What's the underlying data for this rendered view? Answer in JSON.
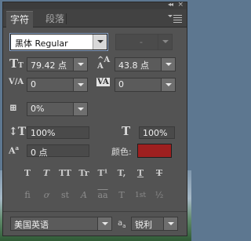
{
  "panel": {
    "tabs": [
      {
        "label": "字符",
        "active": true
      },
      {
        "label": "段落",
        "active": false
      }
    ]
  },
  "font": {
    "family": "黑体 Regular",
    "style": "-"
  },
  "size": {
    "font_size": "79.42 点",
    "leading": "43.8 点"
  },
  "spacing": {
    "kerning": "0",
    "tracking": "0"
  },
  "scale": {
    "tsume": "0%",
    "vertical": "100%",
    "horizontal": "100%"
  },
  "baseline_shift": "0 点",
  "color": {
    "label": "颜色:",
    "swatch_hex": "#9e1f1f"
  },
  "type_styles": [
    "T",
    "T",
    "TT",
    "Tr",
    "T¹",
    "T,",
    "T",
    "T"
  ],
  "opentype": [
    "fi",
    "ơ",
    "st",
    "A",
    "aa",
    "T",
    "1st",
    "½"
  ],
  "language": "美国英语",
  "antialias": {
    "label": "a",
    "value": "锐利"
  },
  "icons": [
    "collapse-icon",
    "close-icon",
    "panel-menu-icon",
    "font-size-icon",
    "leading-icon",
    "kerning-icon",
    "tracking-icon",
    "tsume-icon",
    "vertical-scale-icon",
    "horizontal-scale-icon",
    "baseline-shift-icon"
  ]
}
